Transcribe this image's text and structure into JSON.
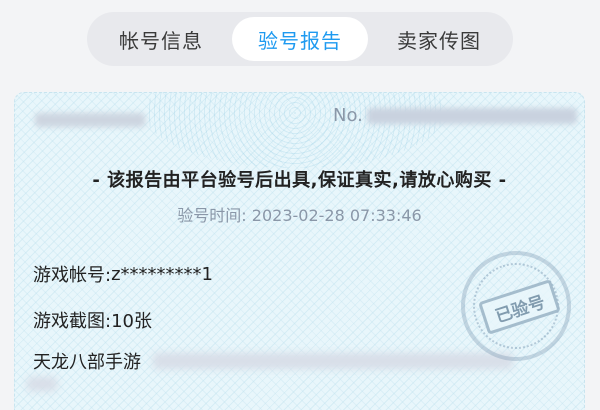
{
  "tabs": [
    {
      "label": "帐号信息",
      "active": false
    },
    {
      "label": "验号报告",
      "active": true
    },
    {
      "label": "卖家传图",
      "active": false
    }
  ],
  "report": {
    "no_label": "No.",
    "headline": "- 该报告由平台验号后出具,保证真实,请放心购买 -",
    "time_label": "验号时间:",
    "time_value": "2023-02-28 07:33:46",
    "account_label": "游戏帐号:",
    "account_value": "z*********1",
    "screenshots_label": "游戏截图:",
    "screenshots_value": "10张",
    "game_name": "天龙八部手游",
    "stamp_text": "已验号"
  },
  "colors": {
    "accent": "#1e9af0",
    "card_bg": "#e8f6fb",
    "muted_text": "#8a97a8"
  }
}
